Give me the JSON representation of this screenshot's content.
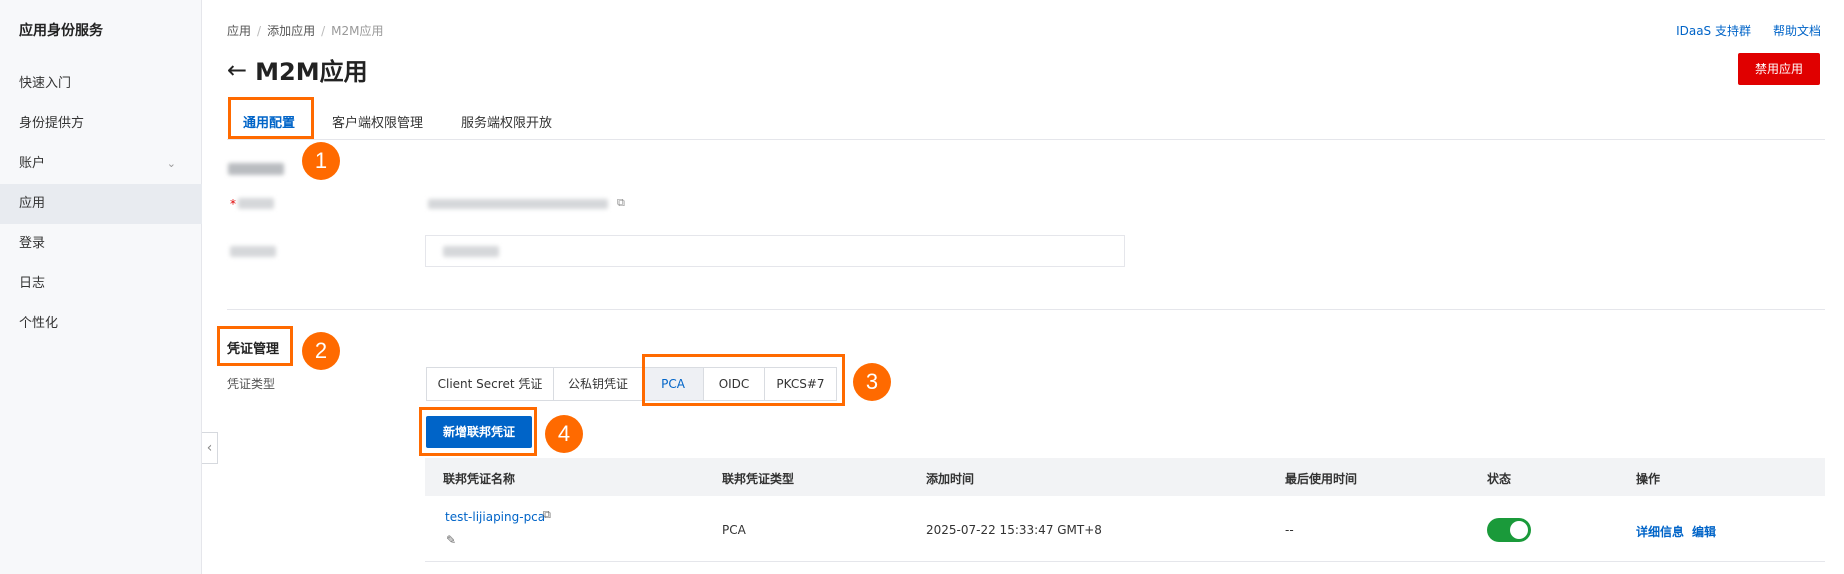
{
  "sidebar": {
    "brand": "应用身份服务",
    "items": [
      {
        "label": "快速入门"
      },
      {
        "label": "身份提供方"
      },
      {
        "label": "账户"
      },
      {
        "label": "应用"
      },
      {
        "label": "登录"
      },
      {
        "label": "日志"
      },
      {
        "label": "个性化"
      }
    ],
    "active_item": "应用"
  },
  "breadcrumb": [
    "应用",
    "添加应用",
    "M2M应用"
  ],
  "top_links": {
    "support": "IDaaS 支持群",
    "docs": "帮助文档"
  },
  "page": {
    "title": "M2M应用",
    "disable_button": "禁用应用"
  },
  "tabs": [
    {
      "label": "通用配置"
    },
    {
      "label": "客户端权限管理"
    },
    {
      "label": "服务端权限开放"
    }
  ],
  "active_tab": "通用配置",
  "annotations": [
    "1",
    "2",
    "3",
    "4"
  ],
  "credential": {
    "section_title": "凭证管理",
    "type_label": "凭证类型",
    "types": [
      {
        "label": "Client Secret 凭证"
      },
      {
        "label": "公私钥凭证"
      },
      {
        "label": "PCA"
      },
      {
        "label": "OIDC"
      },
      {
        "label": "PKCS#7"
      }
    ],
    "active_type": "PCA",
    "add_button": "新增联邦凭证"
  },
  "table": {
    "headers": [
      "联邦凭证名称",
      "联邦凭证类型",
      "添加时间",
      "最后使用时间",
      "状态",
      "操作"
    ],
    "rows": [
      {
        "name": "test-lijiaping-pca",
        "type": "PCA",
        "added_time": "2025-07-22 15:33:47 GMT+8",
        "last_used": "--",
        "enabled": true,
        "actions": [
          "详细信息",
          "编辑"
        ]
      }
    ]
  },
  "colors": {
    "accent": "#0064c8",
    "danger": "#e00000",
    "highlight": "#ff6a00",
    "toggle_on": "#1a9a3a"
  }
}
